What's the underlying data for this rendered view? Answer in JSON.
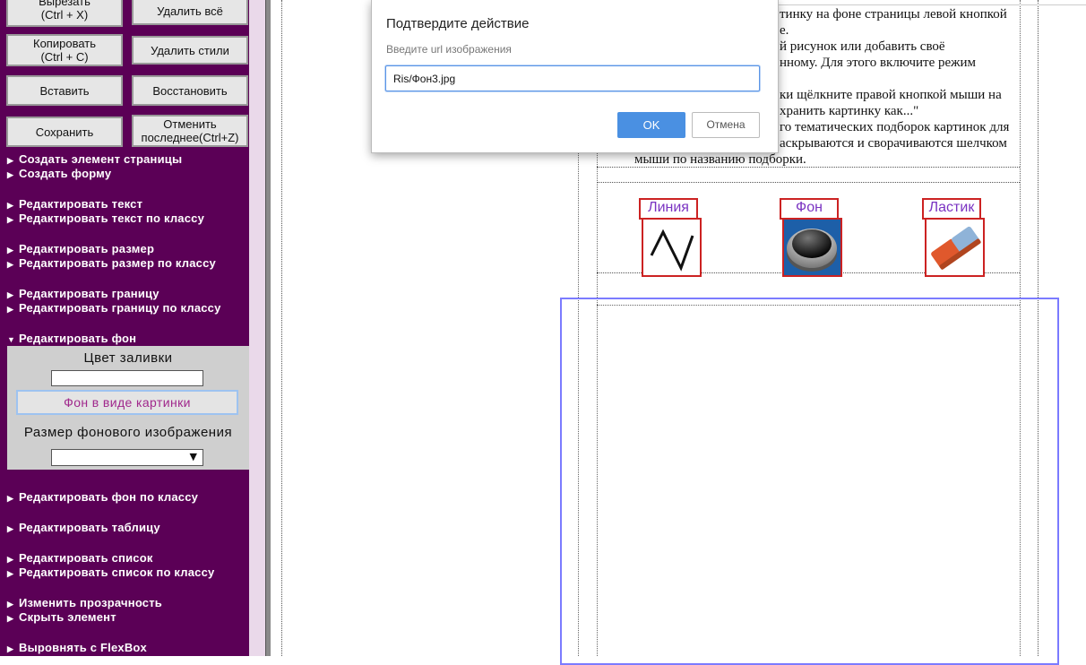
{
  "toolbar": {
    "cut": "Вырезать\n(Ctrl + X)",
    "delete_all": "Удалить всё",
    "copy": "Копировать\n(Ctrl + C)",
    "delete_styles": "Удалить стили",
    "paste": "Вставить",
    "restore": "Восстановить",
    "save": "Сохранить",
    "undo": "Отменить\nпоследнее(Ctrl+Z)"
  },
  "menu": {
    "create_element": "Создать элемент страницы",
    "create_form": "Создать форму",
    "edit_text": "Редактировать текст",
    "edit_text_class": "Редактировать текст по классу",
    "edit_size": "Редактировать размер",
    "edit_size_class": "Редактировать размер по классу",
    "edit_border": "Редактировать границу",
    "edit_border_class": "Редактировать границу по классу",
    "edit_bg": "Редактировать фон",
    "edit_bg_class": "Редактировать фон по классу",
    "edit_table": "Редактировать таблицу",
    "edit_list": "Редактировать список",
    "edit_list_class": "Редактировать список по классу",
    "change_opacity": "Изменить прозрачность",
    "hide_element": "Скрыть элемент",
    "flexbox": "Выровнять с FlexBox"
  },
  "bg_panel": {
    "fill_color_label": "Цвет заливки",
    "fill_color_value": "",
    "image_bg_button": "Фон в виде картинки",
    "image_size_label": "Размер фонового изображения",
    "image_size_value": ""
  },
  "content": {
    "lines": [
      "тинку на фоне страницы левой кнопкой",
      "е.",
      "й рисунок или добавить своё",
      "нному. Для этого включите режим",
      "",
      "ки щёлкните правой кнопкой мыши на",
      "хранить картинку как...\"",
      "го тематических подборок картинок для",
      "аскрываются и сворачиваются шелчком",
      "мыши по названию подборки."
    ]
  },
  "tools": [
    {
      "label": "Линия",
      "icon": "line-icon"
    },
    {
      "label": "Фон",
      "icon": "background-icon"
    },
    {
      "label": "Ластик",
      "icon": "eraser-icon"
    }
  ],
  "dialog": {
    "title": "Подтвердите действие",
    "prompt": "Введите url изображения",
    "input_value": "Ris/Фон3.jpg",
    "ok": "OK",
    "cancel": "Отмена"
  },
  "colors": {
    "sidebar_bg": "#5b0056",
    "ok_button": "#4a90e2",
    "tool_label_text": "#7a33c2",
    "tool_border": "#cc2222",
    "selection_outline": "#7b7bff"
  }
}
